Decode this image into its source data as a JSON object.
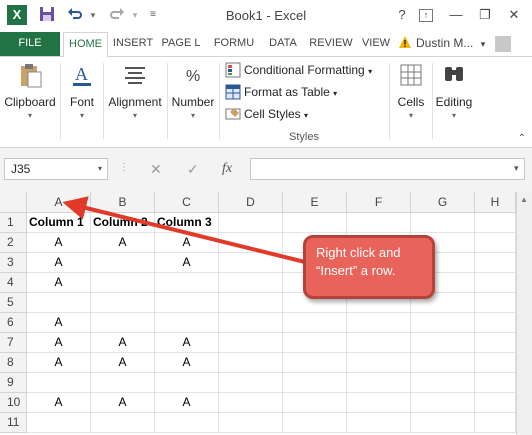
{
  "window": {
    "title": "Book1 - Excel"
  },
  "quick_access": {
    "app_icon": "X",
    "icons": [
      "excel-icon",
      "save-icon",
      "undo-icon",
      "redo-icon",
      "customize-icon"
    ]
  },
  "window_controls": {
    "help": "?",
    "restore_ribbon": "⇪",
    "minimize": "—",
    "maximize": "❐",
    "close": "✕"
  },
  "tabs": [
    {
      "label": "FILE"
    },
    {
      "label": "HOME"
    },
    {
      "label": "INSERT"
    },
    {
      "label": "PAGE L"
    },
    {
      "label": "FORMU"
    },
    {
      "label": "DATA"
    },
    {
      "label": "REVIEW"
    },
    {
      "label": "VIEW"
    }
  ],
  "user": {
    "name": "Dustin M...",
    "caret": "▾"
  },
  "ribbon": {
    "clipboard": "Clipboard",
    "font": "Font",
    "alignment": "Alignment",
    "number": "Number",
    "conditional_formatting": "Conditional Formatting",
    "format_as_table": "Format as Table",
    "cell_styles": "Cell Styles",
    "styles_group": "Styles",
    "cells": "Cells",
    "editing": "Editing",
    "caret": "▾"
  },
  "formula_bar": {
    "name_box": "J35",
    "cancel": "✕",
    "enter": "✓",
    "fx": "fx",
    "value": ""
  },
  "sheet": {
    "columns": [
      "A",
      "B",
      "C",
      "D",
      "E",
      "F",
      "G",
      "H"
    ],
    "rows": [
      "1",
      "2",
      "3",
      "4",
      "5",
      "6",
      "7",
      "8",
      "9",
      "10",
      "11"
    ],
    "cells": [
      [
        "Column 1",
        "Column 2",
        "Column 3"
      ],
      [
        "A",
        "A",
        "A"
      ],
      [
        "A",
        "",
        "A"
      ],
      [
        "A",
        "",
        ""
      ],
      [
        "",
        "",
        ""
      ],
      [
        "A",
        "",
        ""
      ],
      [
        "A",
        "A",
        "A"
      ],
      [
        "A",
        "A",
        "A"
      ],
      [
        "",
        "",
        ""
      ],
      [
        "A",
        "A",
        "A"
      ],
      [
        "",
        "",
        ""
      ]
    ]
  },
  "callout": {
    "line1": "Right click and",
    "line2": "“Insert” a row."
  },
  "colors": {
    "excel_green": "#217346",
    "callout_fill": "#e8635a",
    "callout_border": "#b5433a",
    "arrow": "#e03a2a"
  }
}
